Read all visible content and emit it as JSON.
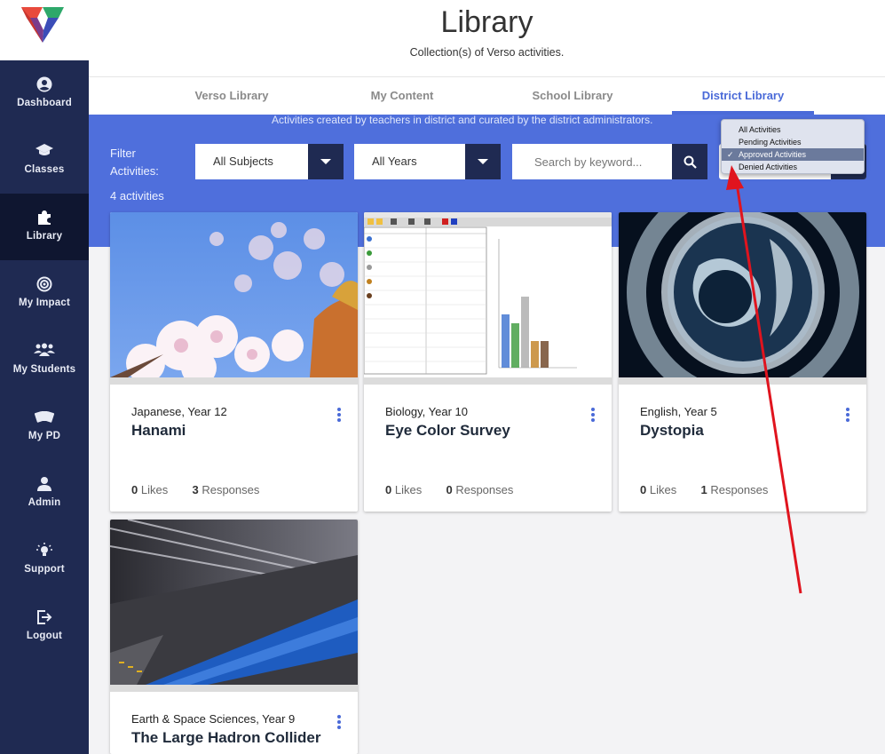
{
  "app": {
    "title": "Library",
    "subtitle": "Collection(s) of Verso activities."
  },
  "sidebar": {
    "items": [
      {
        "label": "Dashboard",
        "icon": "user-circle-icon"
      },
      {
        "label": "Classes",
        "icon": "graduation-cap-icon"
      },
      {
        "label": "Library",
        "icon": "puzzle-piece-icon",
        "active": true
      },
      {
        "label": "My Impact",
        "icon": "target-icon"
      },
      {
        "label": "My Students",
        "icon": "group-icon"
      },
      {
        "label": "My PD",
        "icon": "cards-icon"
      },
      {
        "label": "Admin",
        "icon": "person-icon"
      },
      {
        "label": "Support",
        "icon": "lightbulb-icon"
      },
      {
        "label": "Logout",
        "icon": "logout-icon"
      }
    ]
  },
  "tabs": [
    {
      "label": "Verso Library"
    },
    {
      "label": "My Content"
    },
    {
      "label": "School Library"
    },
    {
      "label": "District Library",
      "active": true
    }
  ],
  "filters": {
    "description": "Activities created by teachers in district and curated by the district administrators.",
    "label": "Filter Activities:",
    "count": "4 activities",
    "subject": "All Subjects",
    "year": "All Years",
    "search_placeholder": "Search by keyword...",
    "status_options": [
      "All Activities",
      "Pending Activities",
      "Approved Activities",
      "Denied Activities"
    ],
    "status_selected": "Approved Activities"
  },
  "cards": [
    {
      "subject": "Japanese, Year 12",
      "title": "Hanami",
      "likes": "0",
      "likes_label": "Likes",
      "responses": "3",
      "responses_label": "Responses"
    },
    {
      "subject": "Biology, Year 10",
      "title": "Eye Color Survey",
      "likes": "0",
      "likes_label": "Likes",
      "responses": "0",
      "responses_label": "Responses"
    },
    {
      "subject": "English, Year 5",
      "title": "Dystopia",
      "likes": "0",
      "likes_label": "Likes",
      "responses": "1",
      "responses_label": "Responses"
    },
    {
      "subject": "Earth & Space Sciences, Year 9",
      "title": "The Large Hadron Collider"
    }
  ],
  "colors": {
    "sidebar": "#1f2a52",
    "accent": "#4a6ad8",
    "band": "#4f6fdc",
    "annotation": "#e0141e"
  }
}
